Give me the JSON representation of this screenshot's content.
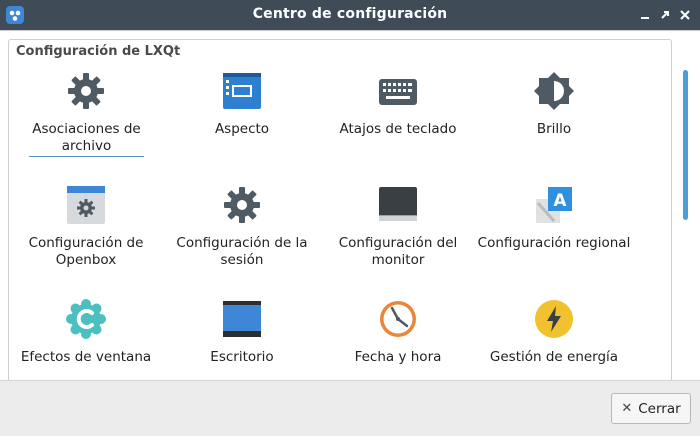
{
  "window": {
    "title": "Centro de configuración",
    "controls": [
      "minimize-icon",
      "maximize-icon",
      "close-icon"
    ]
  },
  "group": {
    "title": "Configuración de LXQt",
    "items": [
      {
        "label": "Asociaciones de archivo",
        "icon": "gear-icon",
        "selected": true
      },
      {
        "label": "Aspecto",
        "icon": "appearance-icon",
        "selected": false
      },
      {
        "label": "Atajos de teclado",
        "icon": "keyboard-icon",
        "selected": false
      },
      {
        "label": "Brillo",
        "icon": "brightness-icon",
        "selected": false
      },
      {
        "label": "Configuración de Openbox",
        "icon": "openbox-icon",
        "selected": false
      },
      {
        "label": "Configuración de la sesión",
        "icon": "gear-icon",
        "selected": false
      },
      {
        "label": "Configuración del monitor",
        "icon": "monitor-icon",
        "selected": false
      },
      {
        "label": "Configuración regional",
        "icon": "locale-icon",
        "selected": false
      },
      {
        "label": "Efectos de ventana",
        "icon": "compositor-icon",
        "selected": false
      },
      {
        "label": "Escritorio",
        "icon": "desktop-icon",
        "selected": false
      },
      {
        "label": "Fecha y hora",
        "icon": "clock-icon",
        "selected": false
      },
      {
        "label": "Gestión de energía",
        "icon": "power-icon",
        "selected": false
      }
    ]
  },
  "footer": {
    "close_label": "Cerrar"
  },
  "colors": {
    "titlebar": "#3f4b57",
    "accent": "#4c9ed8",
    "icon_gray": "#4e5a64",
    "teal": "#4cc0c0",
    "orange": "#e8863a",
    "yellow": "#f2c12e"
  }
}
